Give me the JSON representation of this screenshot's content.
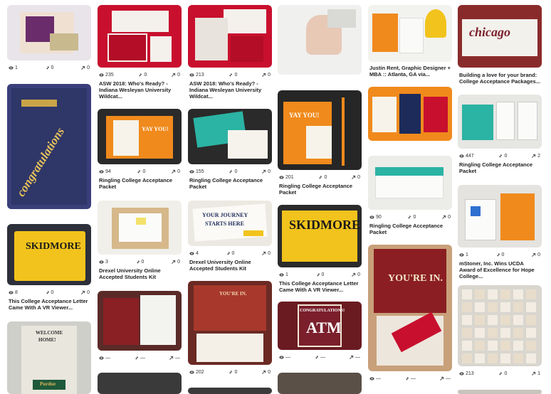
{
  "pins": {
    "c1": [
      {
        "views": "1",
        "pins": "0",
        "repins": "0",
        "title": ""
      },
      {
        "views": "",
        "pins": "",
        "repins": "",
        "title": ""
      },
      {
        "views": "8",
        "pins": "0",
        "repins": "0",
        "title": "This College Acceptance Letter Came With A VR Viewer..."
      },
      {
        "views": "",
        "pins": "",
        "repins": "",
        "title": "",
        "thumb_text": [
          "WELCOME",
          "HOME!",
          "Purdue"
        ]
      }
    ],
    "c2": [
      {
        "views": "235",
        "pins": "0",
        "repins": "0",
        "title": "ASW 2018: Who's Ready? - Indiana Wesleyan University Wildcat..."
      },
      {
        "views": "94",
        "pins": "0",
        "repins": "0",
        "title": "Ringling College Acceptance Packet"
      },
      {
        "views": "3",
        "pins": "0",
        "repins": "0",
        "title": "Drexel University Online Accepted Students Kit"
      },
      {
        "views": "—",
        "pins": "—",
        "repins": "—",
        "title": ""
      }
    ],
    "c3": [
      {
        "views": "213",
        "pins": "0",
        "repins": "0",
        "title": "ASW 2018: Who's Ready? - Indiana Wesleyan University Wildcat..."
      },
      {
        "views": "155",
        "pins": "0",
        "repins": "0",
        "title": "Ringling College Acceptance Packet"
      },
      {
        "views": "4",
        "pins": "0",
        "repins": "0",
        "title": "Drexel University Online Accepted Students Kit",
        "thumb_text": [
          "YOUR JOURNEY",
          "STARTS HERE"
        ]
      },
      {
        "views": "202",
        "pins": "0",
        "repins": "0",
        "title": "",
        "thumb_text": [
          "YOU'RE IN."
        ]
      }
    ],
    "c4": [
      {
        "views": "",
        "pins": "",
        "repins": "",
        "title": ""
      },
      {
        "views": "201",
        "pins": "0",
        "repins": "0",
        "title": "Ringling College Acceptance Packet",
        "thumb_text": [
          "YAY YOU!"
        ]
      },
      {
        "views": "1",
        "pins": "0",
        "repins": "0",
        "title": "This College Acceptance Letter Came With A VR Viewer...",
        "thumb_text": [
          "SKIDMORE"
        ]
      },
      {
        "views": "—",
        "pins": "—",
        "repins": "—",
        "title": "",
        "thumb_text": [
          "CONGRATULATIONS!",
          "ATM"
        ]
      }
    ],
    "c5": [
      {
        "views": "",
        "pins": "",
        "repins": "",
        "title": "Justin Rent, Graphic Designer + MBA :: Atlanta, GA via..."
      },
      {
        "views": "",
        "pins": "",
        "repins": "",
        "title": ""
      },
      {
        "views": "90",
        "pins": "0",
        "repins": "0",
        "title": "Ringling College Acceptance Packet"
      },
      {
        "views": "—",
        "pins": "—",
        "repins": "—",
        "title": "",
        "thumb_text": [
          "YOU'RE IN."
        ]
      }
    ],
    "c6": [
      {
        "views": "",
        "pins": "",
        "repins": "",
        "title": "Building a love for your brand: College Acceptance Packages..."
      },
      {
        "views": "447",
        "pins": "0",
        "repins": "2",
        "title": "Ringling College Acceptance Packet"
      },
      {
        "views": "1",
        "pins": "0",
        "repins": "0",
        "title": "mStoner, Inc. Wins UCDA Award of Excellence for Hope College..."
      },
      {
        "views": "213",
        "pins": "0",
        "repins": "1",
        "title": ""
      }
    ]
  },
  "thumb_text": {
    "congrats": "congratulations",
    "skid1": "SKIDMORE",
    "yay": "YAY YOU!",
    "chicago": "chicago"
  },
  "colors": {
    "orange": "#f08a1c",
    "teal": "#2bb3a3",
    "maroon": "#7a1f2b",
    "red": "#c8102e",
    "navy": "#1d2b5a"
  }
}
